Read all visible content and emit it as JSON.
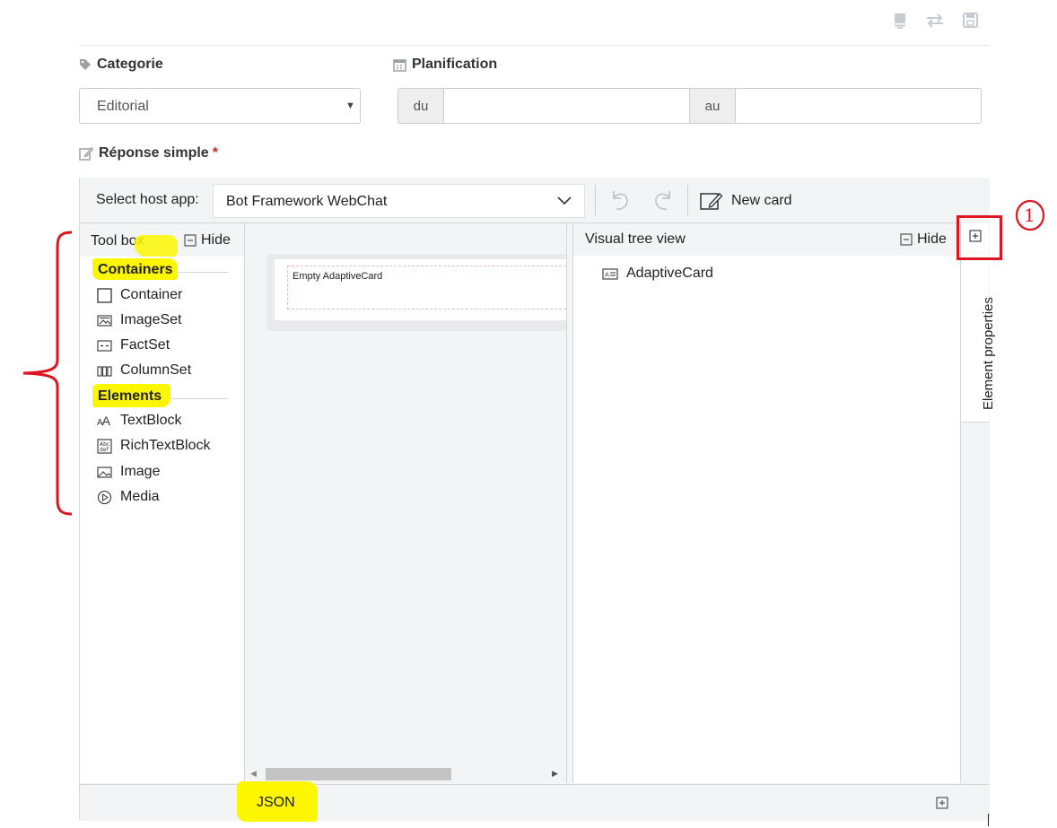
{
  "toolbar_icons": [
    "list-icon",
    "swap-icon",
    "save-icon"
  ],
  "categorie": {
    "label": "Categorie",
    "value": "Editorial"
  },
  "planification": {
    "label": "Planification",
    "from_label": "du",
    "from_value": "",
    "to_label": "au",
    "to_value": ""
  },
  "reponse": {
    "label": "Réponse simple",
    "required_mark": "*"
  },
  "designer": {
    "host_label": "Select host app:",
    "host_value": "Bot Framework WebChat",
    "new_card": "New card",
    "toolbox": {
      "title": "Tool box",
      "hide": "Hide",
      "containers_header": "Containers",
      "containers": [
        "Container",
        "ImageSet",
        "FactSet",
        "ColumnSet"
      ],
      "elements_header": "Elements",
      "elements": [
        "TextBlock",
        "RichTextBlock",
        "Image",
        "Media"
      ]
    },
    "canvas": {
      "empty_card": "Empty AdaptiveCard"
    },
    "visual_tree": {
      "title": "Visual tree view",
      "hide": "Hide",
      "root": "AdaptiveCard"
    },
    "element_properties": "Element properties",
    "json_tab": "JSON"
  },
  "annotation": {
    "number": "1"
  },
  "colors": {
    "highlight": "#fcf600",
    "annotation_red": "#e0141f"
  }
}
